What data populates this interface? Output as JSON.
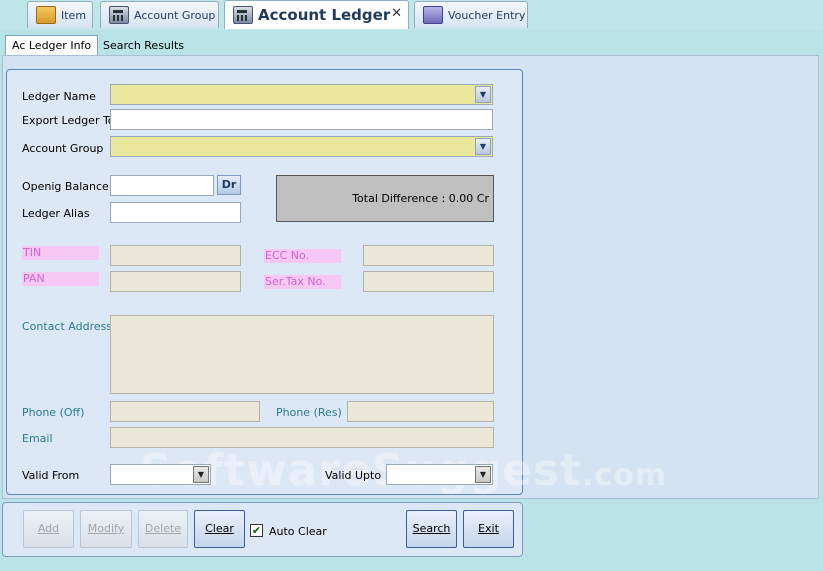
{
  "tabs": [
    {
      "label": "Item",
      "icon": "box-icon"
    },
    {
      "label": "Account Group",
      "icon": "calculator-icon"
    },
    {
      "label": "Account Ledger",
      "icon": "calculator-icon"
    },
    {
      "label": "Voucher Entry",
      "icon": "voucher-icon"
    }
  ],
  "active_tab_close": "✕",
  "subtabs": [
    "Ac Ledger Info",
    "Search Results"
  ],
  "form": {
    "ledger_name_label": "Ledger Name",
    "export_ledger_label": "Export Ledger To",
    "account_group_label": "Account Group",
    "opening_balance_label": "Openig Balance",
    "dr_label": "Dr",
    "ledger_alias_label": "Ledger Alias",
    "total_difference": "Total Difference : 0.00 Cr",
    "tin_label": "TIN",
    "pan_label": "PAN",
    "ecc_label": "ECC No.",
    "sertax_label": "Ser.Tax No.",
    "contact_address_label": "Contact Address",
    "phone_off_label": "Phone (Off)",
    "phone_res_label": "Phone (Res)",
    "email_label": "Email",
    "valid_from_label": "Valid From",
    "valid_upto_label": "Valid Upto",
    "dropdown_arrow": "▼"
  },
  "buttons": {
    "add": "Add",
    "modify": "Modify",
    "delete": "Delete",
    "clear": "Clear",
    "auto_clear": "Auto Clear",
    "auto_clear_checked": "✔",
    "search": "Search",
    "exit": "Exit"
  },
  "watermark": {
    "main": "SoftwareSuggest",
    "suffix": ".com"
  },
  "colors": {
    "required_field": "#e9e89c",
    "disabled_field": "#ebe8da",
    "optional_label": "#f7c8f4"
  }
}
